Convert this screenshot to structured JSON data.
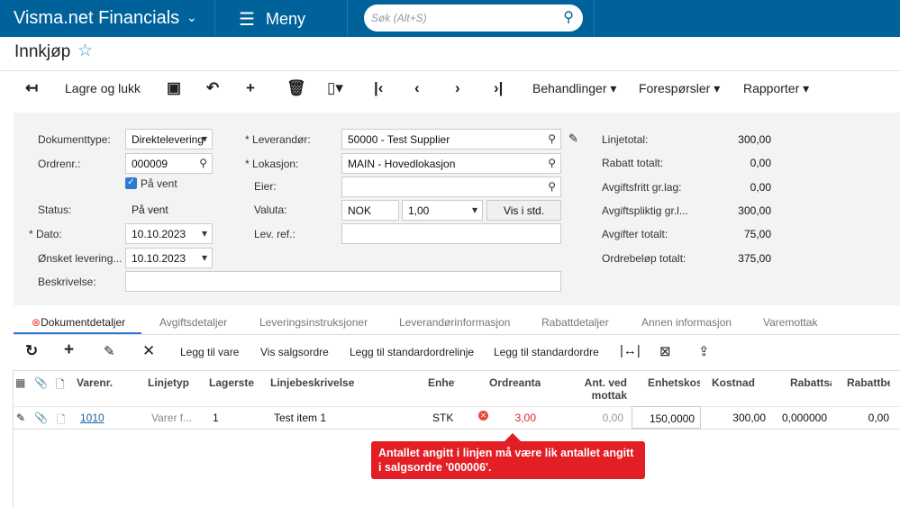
{
  "header": {
    "app": "Visma.net Financials",
    "menu": "Meny",
    "search_placeholder": "Søk (Alt+S)"
  },
  "page": {
    "title": "Innkjøp"
  },
  "toolbar": {
    "save_close": "Lagre og lukk",
    "actions": "Behandlinger",
    "inquiries": "Forespørsler",
    "reports": "Rapporter"
  },
  "form": {
    "doc_type_label": "Dokumenttype:",
    "doc_type": "Direktelevering",
    "order_label": "Ordrenr.:",
    "order": "000009",
    "hold_label": "På vent",
    "hold_checked": true,
    "status_label": "Status:",
    "status": "På vent",
    "date_label": "Dato:",
    "date": "10.10.2023",
    "delivery_label": "Ønsket levering...",
    "delivery": "10.10.2023",
    "desc_label": "Beskrivelse:",
    "desc": "",
    "supplier_label": "Leverandør:",
    "supplier": "50000 - Test Supplier",
    "location_label": "Lokasjon:",
    "location": "MAIN - Hovedlokasjon",
    "owner_label": "Eier:",
    "owner": "",
    "currency_label": "Valuta:",
    "currency": "NOK",
    "rate": "1,00",
    "view_base": "Vis i std.",
    "ref_label": "Lev. ref.:",
    "ref": ""
  },
  "totals": [
    {
      "label": "Linjetotal:",
      "value": "300,00"
    },
    {
      "label": "Rabatt totalt:",
      "value": "0,00"
    },
    {
      "label": "Avgiftsfritt gr.lag:",
      "value": "0,00"
    },
    {
      "label": "Avgiftspliktig gr.l...",
      "value": "300,00"
    },
    {
      "label": "Avgifter totalt:",
      "value": "75,00"
    },
    {
      "label": "Ordrebeløp totalt:",
      "value": "375,00"
    }
  ],
  "tabs": [
    "Dokumentdetaljer",
    "Avgiftsdetaljer",
    "Leveringsinstruksjoner",
    "Leverandørinformasjon",
    "Rabattdetaljer",
    "Annen informasjon",
    "Varemottak"
  ],
  "grid_toolbar": [
    "Legg til vare",
    "Vis salgsordre",
    "Legg til standardordrelinje",
    "Legg til standardordre"
  ],
  "columns": [
    "Varenr.",
    "Linjetyp",
    "Lagerste",
    "Linjebeskrivelse",
    "Enhet",
    "Ordreanta",
    "Ant. ved mottak",
    "Enhetskos",
    "Kostnad",
    "Rabattsa",
    "Rabattbe"
  ],
  "row": {
    "item": "1010",
    "type": "Varer f...",
    "warehouse": "1",
    "desc": "Test item 1",
    "uom": "STK",
    "qty": "3,00",
    "received": "0,00",
    "unit_cost": "150,0000",
    "cost": "300,00",
    "disc_pct": "0,000000",
    "disc_amt": "0,00"
  },
  "error": "Antallet angitt i linjen må være lik antallet angitt i salgsordre '000006'.",
  "colors": {
    "header": "#00629b",
    "error": "#e31e24"
  }
}
